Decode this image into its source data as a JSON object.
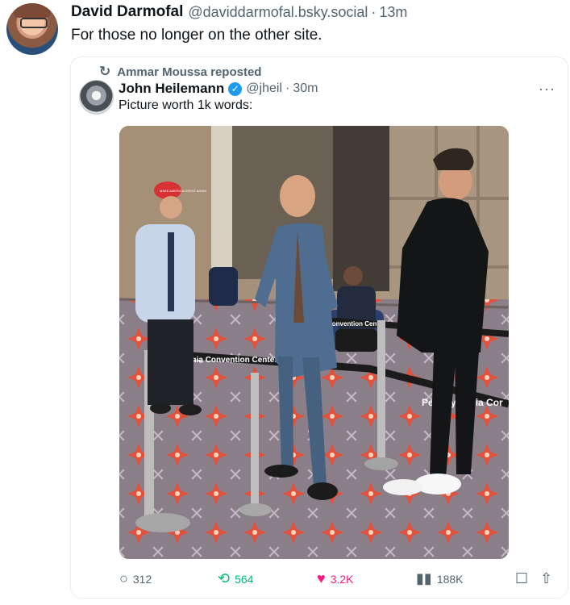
{
  "outer_post": {
    "author_name": "David Darmofal",
    "handle": "@daviddarmofal.bsky.social",
    "separator": "·",
    "time": "13m",
    "text": "For those no longer on the other site."
  },
  "quoted_post": {
    "repost_label": "Ammar Moussa reposted",
    "author_name": "John Heilemann",
    "handle": "@jheil",
    "separator": "·",
    "time": "30m",
    "text": "Picture worth 1k words:",
    "more_label": "···",
    "image_texts": {
      "hat_text": "MAKE AMERICA GREAT AGAIN",
      "belt_left": "Pennsylvania Convention Center",
      "belt_right": "Pennsylvania Cor",
      "belt_back": "Convention Center"
    },
    "stats": {
      "replies": "312",
      "reposts": "564",
      "likes": "3.2K",
      "views": "188K"
    }
  },
  "icons": {
    "reply": "reply-icon",
    "repost": "repost-icon",
    "like": "heart-icon",
    "views": "views-icon",
    "bookmark": "bookmark-icon",
    "share": "share-icon"
  },
  "colors": {
    "verified": "#1d9bf0",
    "repost_green": "#00ba7c",
    "like_pink": "#f91880",
    "secondary_text": "#536471"
  }
}
